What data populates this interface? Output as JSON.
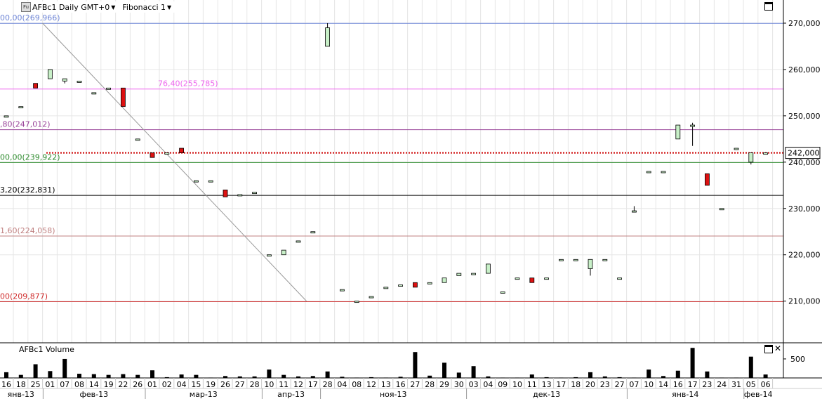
{
  "window": {
    "symbol_label": "AFBc1 Daily GMT+0",
    "study_label": "Fibonacci 1",
    "price_tag": "242,000",
    "volume_title": "AFBc1 Volume",
    "icons": [
      "fu-icon",
      "dropdown-caret-icon",
      "maximize-icon",
      "close-icon"
    ]
  },
  "chart_data": {
    "type": "candlestick",
    "ylim": [
      201000,
      275000
    ],
    "price_ticks": [
      "270,000",
      "260,000",
      "250,000",
      "240,000",
      "230,000",
      "220,000",
      "210,000"
    ],
    "price_tick_values": [
      270000,
      260000,
      250000,
      240000,
      230000,
      220000,
      210000
    ],
    "current_price": 242000,
    "fib_levels": [
      {
        "label": "00,00(269,966)",
        "value": 269966,
        "color": "#6f86d6"
      },
      {
        "label": "76,40(255,785)",
        "value": 255785,
        "color": "#ee66ee"
      },
      {
        "label": ",80(247,012)",
        "value": 247012,
        "color": "#994499"
      },
      {
        "label": "00,00(239,922)",
        "value": 239922,
        "color": "#2e8b2e"
      },
      {
        "label": "3,20(232,831)",
        "value": 232831,
        "color": "#000000"
      },
      {
        "label": "1,60(224,058)",
        "value": 224058,
        "color": "#c08080"
      },
      {
        "label": "00(209,877)",
        "value": 209877,
        "color": "#d03030"
      }
    ],
    "fib_label_positions": [
      "left",
      "center",
      "left",
      "left",
      "left",
      "left",
      "left"
    ],
    "trend_line": {
      "from": {
        "date": "25 янв-13",
        "value": 270000
      },
      "to": {
        "date": "28 ноя-13",
        "value": 210000
      }
    },
    "x_labels": [
      "16",
      "18",
      "25",
      "01",
      "07",
      "08",
      "14",
      "19",
      "22",
      "26",
      "01",
      "02",
      "04",
      "15",
      "19",
      "26",
      "27",
      "28",
      "10",
      "11",
      "12",
      "17",
      "28",
      "04",
      "08",
      "12",
      "13",
      "16",
      "27",
      "28",
      "29",
      "30",
      "03",
      "04",
      "09",
      "10",
      "11",
      "13",
      "17",
      "18",
      "20",
      "23",
      "27",
      "07",
      "10",
      "14",
      "16",
      "17",
      "23",
      "24",
      "31",
      "05",
      "06"
    ],
    "months": [
      {
        "label": "янв-13",
        "start": 0,
        "end": 2
      },
      {
        "label": "фев-13",
        "start": 3,
        "end": 9
      },
      {
        "label": "мар-13",
        "start": 10,
        "end": 17
      },
      {
        "label": "апр-13",
        "start": 18,
        "end": 21
      },
      {
        "label": "ноя-13",
        "start": 22,
        "end": 31
      },
      {
        "label": "дек-13",
        "start": 32,
        "end": 42
      },
      {
        "label": "янв-14",
        "start": 43,
        "end": 50
      },
      {
        "label": "фев-14",
        "start": 51,
        "end": 52
      }
    ],
    "candles": [
      {
        "o": 250000,
        "h": 250000,
        "l": 250000,
        "c": 250000
      },
      {
        "o": 252000,
        "h": 252000,
        "l": 252000,
        "c": 252000
      },
      {
        "o": 257000,
        "h": 257000,
        "l": 256000,
        "c": 256000
      },
      {
        "o": 258000,
        "h": 260000,
        "l": 258000,
        "c": 260000
      },
      {
        "o": 257500,
        "h": 258000,
        "l": 257000,
        "c": 258000
      },
      {
        "o": 257500,
        "h": 257500,
        "l": 257500,
        "c": 257500
      },
      {
        "o": 255000,
        "h": 255000,
        "l": 255000,
        "c": 255000
      },
      {
        "o": 256000,
        "h": 256000,
        "l": 256000,
        "c": 256000
      },
      {
        "o": 256000,
        "h": 256000,
        "l": 252000,
        "c": 252000
      },
      {
        "o": 245000,
        "h": 245000,
        "l": 245000,
        "c": 245000
      },
      {
        "o": 242000,
        "h": 242000,
        "l": 241000,
        "c": 241000
      },
      {
        "o": 242000,
        "h": 242000,
        "l": 242000,
        "c": 242000
      },
      {
        "o": 243000,
        "h": 243000,
        "l": 242000,
        "c": 242000
      },
      {
        "o": 236000,
        "h": 236000,
        "l": 236000,
        "c": 236000
      },
      {
        "o": 236000,
        "h": 236000,
        "l": 236000,
        "c": 236000
      },
      {
        "o": 234000,
        "h": 234000,
        "l": 232500,
        "c": 232500
      },
      {
        "o": 233000,
        "h": 233000,
        "l": 233000,
        "c": 233000
      },
      {
        "o": 233500,
        "h": 233500,
        "l": 233500,
        "c": 233500
      },
      {
        "o": 220000,
        "h": 220000,
        "l": 220000,
        "c": 220000
      },
      {
        "o": 220000,
        "h": 221000,
        "l": 220000,
        "c": 221000
      },
      {
        "o": 223000,
        "h": 223000,
        "l": 223000,
        "c": 223000
      },
      {
        "o": 225000,
        "h": 225000,
        "l": 225000,
        "c": 225000
      },
      {
        "o": 265000,
        "h": 270000,
        "l": 265000,
        "c": 269000
      },
      {
        "o": 212500,
        "h": 212500,
        "l": 212500,
        "c": 212500
      },
      {
        "o": 210000,
        "h": 210000,
        "l": 210000,
        "c": 210000
      },
      {
        "o": 211000,
        "h": 211000,
        "l": 211000,
        "c": 211000
      },
      {
        "o": 213000,
        "h": 213000,
        "l": 213000,
        "c": 213000
      },
      {
        "o": 213500,
        "h": 213500,
        "l": 213500,
        "c": 213500
      },
      {
        "o": 214000,
        "h": 214000,
        "l": 213000,
        "c": 213000
      },
      {
        "o": 214000,
        "h": 214000,
        "l": 214000,
        "c": 214000
      },
      {
        "o": 214000,
        "h": 215000,
        "l": 214000,
        "c": 215000
      },
      {
        "o": 215500,
        "h": 216000,
        "l": 215500,
        "c": 216000
      },
      {
        "o": 216000,
        "h": 216000,
        "l": 216000,
        "c": 216000
      },
      {
        "o": 216000,
        "h": 218000,
        "l": 216000,
        "c": 218000
      },
      {
        "o": 212000,
        "h": 212000,
        "l": 212000,
        "c": 212000
      },
      {
        "o": 215000,
        "h": 215000,
        "l": 215000,
        "c": 215000
      },
      {
        "o": 215000,
        "h": 215000,
        "l": 214000,
        "c": 214000
      },
      {
        "o": 215000,
        "h": 215000,
        "l": 215000,
        "c": 215000
      },
      {
        "o": 219000,
        "h": 219000,
        "l": 219000,
        "c": 219000
      },
      {
        "o": 219000,
        "h": 219000,
        "l": 219000,
        "c": 219000
      },
      {
        "o": 217000,
        "h": 219000,
        "l": 215500,
        "c": 219000
      },
      {
        "o": 219000,
        "h": 219000,
        "l": 219000,
        "c": 219000
      },
      {
        "o": 215000,
        "h": 215000,
        "l": 215000,
        "c": 215000
      },
      {
        "o": 229500,
        "h": 230500,
        "l": 229500,
        "c": 229500
      },
      {
        "o": 238000,
        "h": 238000,
        "l": 238000,
        "c": 238000
      },
      {
        "o": 238000,
        "h": 238000,
        "l": 238000,
        "c": 238000
      },
      {
        "o": 245000,
        "h": 248000,
        "l": 245000,
        "c": 248000
      },
      {
        "o": 248000,
        "h": 248500,
        "l": 243500,
        "c": 248000
      },
      {
        "o": 237500,
        "h": 237500,
        "l": 235000,
        "c": 235000
      },
      {
        "o": 230000,
        "h": 230000,
        "l": 230000,
        "c": 230000
      },
      {
        "o": 243000,
        "h": 243000,
        "l": 243000,
        "c": 243000
      },
      {
        "o": 240000,
        "h": 242000,
        "l": 239500,
        "c": 242000
      },
      {
        "o": 242000,
        "h": 242000,
        "l": 242000,
        "c": 242000
      }
    ],
    "volume_tick": "500",
    "volume_tick_value": 500,
    "volume_max": 850,
    "volumes": [
      150,
      80,
      360,
      180,
      500,
      110,
      100,
      80,
      100,
      80,
      200,
      20,
      90,
      80,
      10,
      50,
      40,
      40,
      220,
      80,
      40,
      50,
      170,
      30,
      10,
      20,
      10,
      30,
      680,
      60,
      400,
      140,
      310,
      40,
      10,
      10,
      90,
      20,
      10,
      20,
      150,
      40,
      20,
      10,
      220,
      50,
      190,
      790,
      170,
      10,
      10,
      560,
      90
    ]
  }
}
